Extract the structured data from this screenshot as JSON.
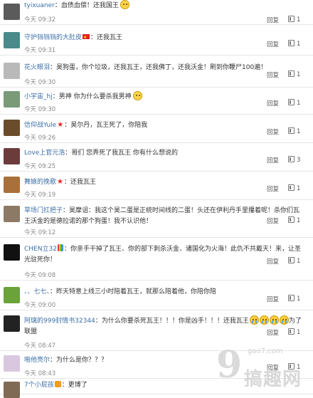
{
  "comments": [
    {
      "user": "tyixuaner",
      "text": "：血债血偿！还我国王",
      "time": "今天 09:32",
      "reply": "回复",
      "likes": "1",
      "avatar_color": "#5b5b5b",
      "emoji_after": "smile"
    },
    {
      "user": "守护铛铛铛的大肚皮",
      "text": "：还我瓦王",
      "time": "今天 09:31",
      "reply": "回复",
      "likes": "1",
      "avatar_color": "#4a8a8a",
      "badge": "flag"
    },
    {
      "user": "花火眼泪",
      "text": "：昊狗蛋，你个垃圾，还我瓦王，还我佛丁，还我沃金！刷到你鞭尸100遍！",
      "time": "今天 09:30",
      "reply": "回复",
      "likes": "1",
      "avatar_color": "#b9b9b9"
    },
    {
      "user": "小宇宙_hj",
      "text": "：男神 你为什么要杀我男神",
      "time": "今天 09:30",
      "reply": "回复",
      "likes": "1",
      "avatar_color": "#7a9a78",
      "emoji_after": "smile"
    },
    {
      "user": "信仰战Yule",
      "text": "：昊尔丹，瓦王死了，你陪我",
      "time": "今天 09:26",
      "reply": "回复",
      "likes": "1",
      "avatar_color": "#6b4c2a",
      "badge": "star"
    },
    {
      "user": "Love上官元浩",
      "text": "：哥们  您弄死了我瓦王   你有什么想说的",
      "time": "今天 09:25",
      "reply": "回复",
      "likes": "3",
      "avatar_color": "#6c3c3c"
    },
    {
      "user": "舞娘的挽歌",
      "text": "：还我瓦王",
      "time": "今天 09:19",
      "reply": "回复",
      "likes": "1",
      "avatar_color": "#a8703a",
      "badge": "star"
    },
    {
      "user": "草场门扛把子",
      "text": "：昊摩诅：我这个昊二蛋是正统时间线的二蛋！头还在伊利丹手里攥着呢！杀你们瓦王沃金的是德拉诺的那个狗蛋！我不认识他！",
      "time": "今天 09:12",
      "reply": "回复",
      "likes": "1",
      "avatar_color": "#8d7a66"
    },
    {
      "user": "CHEN立32",
      "text": "：你亲手干掉了瓦王、你的部下刺杀沃金、诸国化为火海！此仇不共戴天！来，让圣光驻死你！",
      "time": "今天 09:08",
      "reply": "回复",
      "likes": "1",
      "avatar_color": "#111111",
      "badge": "heart"
    },
    {
      "user": "、、七七、",
      "text": "：昨天特意上线三小时陪着瓦王，就那么陪着他，你陪你陪",
      "time": "今天 09:00",
      "reply": "回复",
      "likes": "1",
      "avatar_color": "#6aa33a"
    },
    {
      "user": "阿璃的999封情书32344",
      "text": "：为什么你要杀死瓦王！！！你是凶手！！！还我瓦王",
      "text_after": "为了联盟",
      "time": "今天 08:47",
      "reply": "回复",
      "likes": "1",
      "avatar_color": "#222222",
      "cry_count": 4
    },
    {
      "user": "啪他亮尔",
      "text": "：为什么是你？？？",
      "time": "今天 08:43",
      "reply": "回复",
      "likes": "1",
      "avatar_color": "#d9c7e0"
    },
    {
      "user": "7个小屁孩",
      "text": "：更博了",
      "time": "",
      "reply": "",
      "likes": "",
      "avatar_color": "#7f6a55",
      "badge": "cat"
    }
  ],
  "watermark": {
    "url": "gao7.com",
    "logo": "搞趣网",
    "mark": "9"
  }
}
